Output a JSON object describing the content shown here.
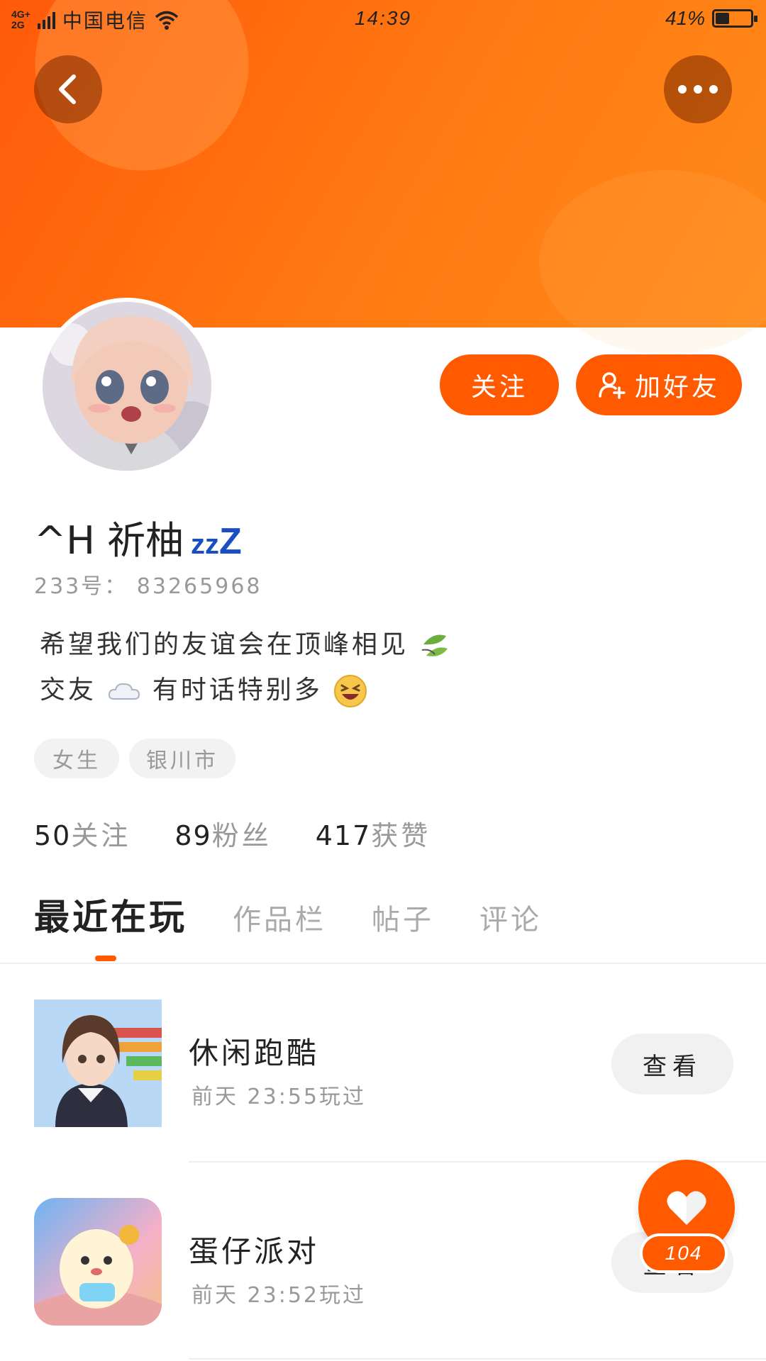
{
  "status_bar": {
    "network": "4G+ 2G",
    "carrier": "中国电信",
    "time": "14:39",
    "battery": "41%",
    "battery_level": 0.41
  },
  "header": {
    "back_icon": "chevron-left-icon",
    "more_icon": "more-dots-icon",
    "banner_color": "#ff6a10"
  },
  "profile": {
    "name": "^H  祈柚",
    "name_suffix_small": "zz",
    "name_suffix_big": "Z",
    "uid": "233号： 83265968",
    "bio_line1": "希望我们的友谊会在顶峰相见",
    "bio_line2_a": "交友",
    "bio_line2_b": " 有时话特别多",
    "tags": [
      "女生",
      "银川市"
    ]
  },
  "actions": {
    "follow_label": "关注",
    "add_friend_label": "加好友"
  },
  "stats": [
    {
      "num": "50",
      "label": "关注"
    },
    {
      "num": "89",
      "label": "粉丝"
    },
    {
      "num": "417",
      "label": "获赞"
    }
  ],
  "tabs": [
    "最近在玩",
    "作品栏",
    "帖子",
    "评论"
  ],
  "games": [
    {
      "title": "休闲跑酷",
      "time": "前天 23:55玩过",
      "button": "查看"
    },
    {
      "title": "蛋仔派对",
      "time": "前天 23:52玩过",
      "button": "查看"
    }
  ],
  "like": {
    "count": "104"
  },
  "colors": {
    "accent": "#ff5a00",
    "zzz": "#1a4fc4"
  }
}
